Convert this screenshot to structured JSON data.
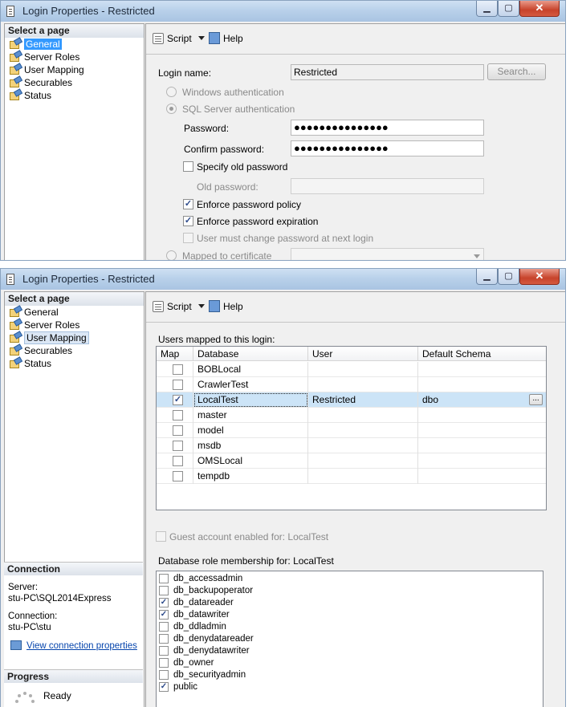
{
  "window1": {
    "title": "Login Properties - Restricted",
    "sidebar": {
      "header": "Select a page",
      "items": [
        "General",
        "Server Roles",
        "User Mapping",
        "Securables",
        "Status"
      ]
    },
    "toolbar": {
      "script": "Script",
      "help": "Help"
    },
    "general": {
      "login_name_label": "Login name:",
      "login_name_value": "Restricted",
      "search_button": "Search...",
      "windows_auth": "Windows authentication",
      "sql_auth": "SQL Server authentication",
      "password_label": "Password:",
      "password_value": "●●●●●●●●●●●●●●●",
      "confirm_label": "Confirm password:",
      "confirm_value": "●●●●●●●●●●●●●●●",
      "specify_old": "Specify old password",
      "old_password_label": "Old password:",
      "enforce_policy": "Enforce password policy",
      "enforce_expiration": "Enforce password expiration",
      "must_change": "User must change password at next login",
      "mapped_cert": "Mapped to certificate"
    }
  },
  "window2": {
    "title": "Login Properties - Restricted",
    "sidebar": {
      "header": "Select a page",
      "items": [
        "General",
        "Server Roles",
        "User Mapping",
        "Securables",
        "Status"
      ]
    },
    "toolbar": {
      "script": "Script",
      "help": "Help"
    },
    "mapping": {
      "users_mapped_label": "Users mapped to this login:",
      "columns": [
        "Map",
        "Database",
        "User",
        "Default Schema"
      ],
      "rows": [
        {
          "map": false,
          "database": "BOBLocal",
          "user": "",
          "schema": ""
        },
        {
          "map": false,
          "database": "CrawlerTest",
          "user": "",
          "schema": ""
        },
        {
          "map": true,
          "database": "LocalTest",
          "user": "Restricted",
          "schema": "dbo"
        },
        {
          "map": false,
          "database": "master",
          "user": "",
          "schema": ""
        },
        {
          "map": false,
          "database": "model",
          "user": "",
          "schema": ""
        },
        {
          "map": false,
          "database": "msdb",
          "user": "",
          "schema": ""
        },
        {
          "map": false,
          "database": "OMSLocal",
          "user": "",
          "schema": ""
        },
        {
          "map": false,
          "database": "tempdb",
          "user": "",
          "schema": ""
        }
      ],
      "ellipsis": "...",
      "guest_label": "Guest account enabled for: LocalTest",
      "role_label": "Database role membership for: LocalTest",
      "roles": [
        {
          "name": "db_accessadmin",
          "checked": false
        },
        {
          "name": "db_backupoperator",
          "checked": false
        },
        {
          "name": "db_datareader",
          "checked": true
        },
        {
          "name": "db_datawriter",
          "checked": true
        },
        {
          "name": "db_ddladmin",
          "checked": false
        },
        {
          "name": "db_denydatareader",
          "checked": false
        },
        {
          "name": "db_denydatawriter",
          "checked": false
        },
        {
          "name": "db_owner",
          "checked": false
        },
        {
          "name": "db_securityadmin",
          "checked": false
        },
        {
          "name": "public",
          "checked": true
        }
      ]
    },
    "connection": {
      "header": "Connection",
      "server_label": "Server:",
      "server_value": "stu-PC\\SQL2014Express",
      "conn_label": "Connection:",
      "conn_value": "stu-PC\\stu",
      "view_link": "View connection properties"
    },
    "progress": {
      "header": "Progress",
      "status": "Ready"
    }
  },
  "check_glyph": "✓",
  "colors": {
    "selection": "#3399ff",
    "row_selected": "#cce4f7",
    "link": "#0645ad",
    "title_gradient": "#b9d1ea"
  }
}
